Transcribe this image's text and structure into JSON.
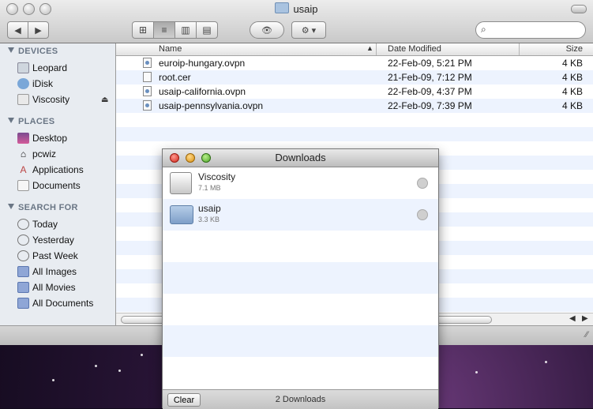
{
  "window": {
    "title": "usaip"
  },
  "toolbar": {
    "back": "◀",
    "forward": "▶",
    "view_icons": "⊞",
    "view_list": "≡",
    "view_columns": "▥",
    "view_coverflow": "▤",
    "quicklook": "👁",
    "action": "⚙ ▾",
    "search_placeholder": ""
  },
  "sidebar": {
    "devices_header": "DEVICES",
    "devices": [
      "Leopard",
      "iDisk",
      "Viscosity"
    ],
    "places_header": "PLACES",
    "places": [
      "Desktop",
      "pcwiz",
      "Applications",
      "Documents"
    ],
    "search_header": "SEARCH FOR",
    "searches": [
      "Today",
      "Yesterday",
      "Past Week",
      "All Images",
      "All Movies",
      "All Documents"
    ]
  },
  "columns": {
    "name": "Name",
    "date": "Date Modified",
    "size": "Size"
  },
  "files": [
    {
      "name": "euroip-hungary.ovpn",
      "date": "22-Feb-09, 5:21 PM",
      "size": "4 KB",
      "icon": "ovpn-doc-icon"
    },
    {
      "name": "root.cer",
      "date": "21-Feb-09, 7:12 PM",
      "size": "4 KB",
      "icon": "blank-doc-icon"
    },
    {
      "name": "usaip-california.ovpn",
      "date": "22-Feb-09, 4:37 PM",
      "size": "4 KB",
      "icon": "ovpn-doc-icon"
    },
    {
      "name": "usaip-pennsylvania.ovpn",
      "date": "22-Feb-09, 7:39 PM",
      "size": "4 KB",
      "icon": "ovpn-doc-icon"
    }
  ],
  "downloads": {
    "title": "Downloads",
    "items": [
      {
        "name": "Viscosity",
        "size": "7.1 MB",
        "icon": "disk-image-icon"
      },
      {
        "name": "usaip",
        "size": "3.3 KB",
        "icon": "folder-icon"
      }
    ],
    "clear_label": "Clear",
    "count_label": "2 Downloads"
  }
}
